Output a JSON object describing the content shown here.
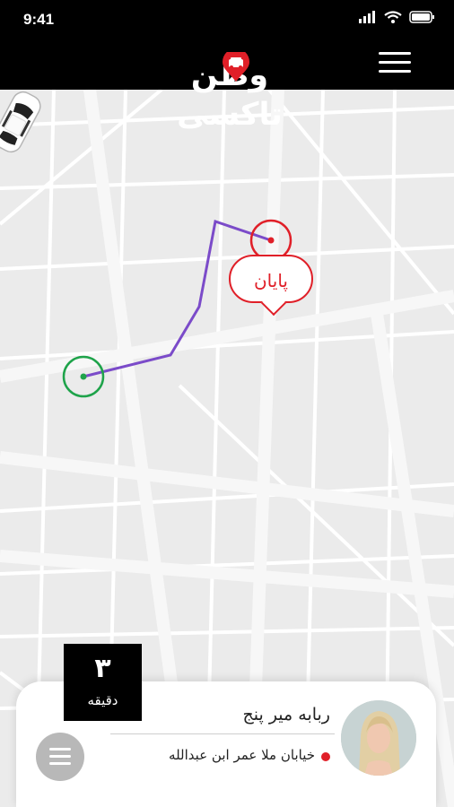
{
  "status_bar": {
    "time": "9:41"
  },
  "header": {
    "app_name": "وطن تاکسی"
  },
  "map": {
    "end_label": "پایان"
  },
  "eta": {
    "value": "۳",
    "unit": "دقیقه"
  },
  "driver": {
    "name": "ربابه میر پنج",
    "address": "خیابان ملا عمر ابن عبدالله"
  },
  "colors": {
    "brand_red": "#e01f28",
    "route_purple": "#7b4bc9",
    "start_green": "#1ea34a"
  },
  "icons": [
    "signal-icon",
    "wifi-icon",
    "battery-icon",
    "menu-icon",
    "car-pin-icon",
    "car-icon"
  ]
}
